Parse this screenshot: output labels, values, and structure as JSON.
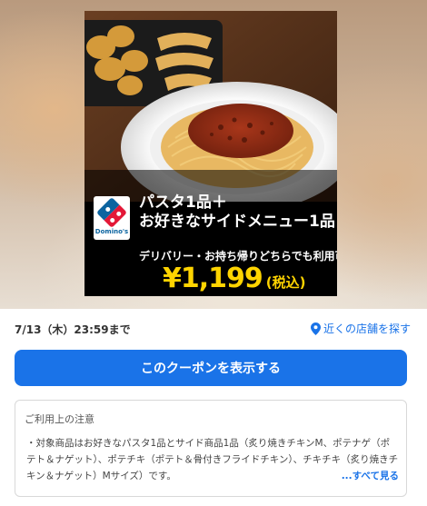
{
  "coupon": {
    "headline_1": "パスタ1品＋",
    "headline_2": "お好きなサイドメニュー1品",
    "subline": "デリバリー・お持ち帰りどちらでも利用可能",
    "price": "¥1,199",
    "tax": "(税込)",
    "logo_text": "Domino's"
  },
  "expiry": "7/13（木）23:59まで",
  "nearby_label": "近くの店舗を探す",
  "show_button": "このクーポンを表示する",
  "notes": {
    "title": "ご利用上の注意",
    "body": "・対象商品はお好きなパスタ1品とサイド商品1品（炙り焼きチキンM、ポテナゲ（ポテト＆ナゲット）、ポテチキ（ポテト＆骨付きフライドチキン）、チキチキ（炙り焼きチキン＆ナゲット）Mサイズ）です。",
    "see_more": "...すべて見る"
  },
  "colors": {
    "accent": "#1a73e8",
    "price_yellow": "#ffd400",
    "brand_blue": "#0b64a0",
    "brand_red": "#e31837"
  },
  "icons": {
    "nearby": "map-pin-icon",
    "logo": "dominos-logo"
  }
}
